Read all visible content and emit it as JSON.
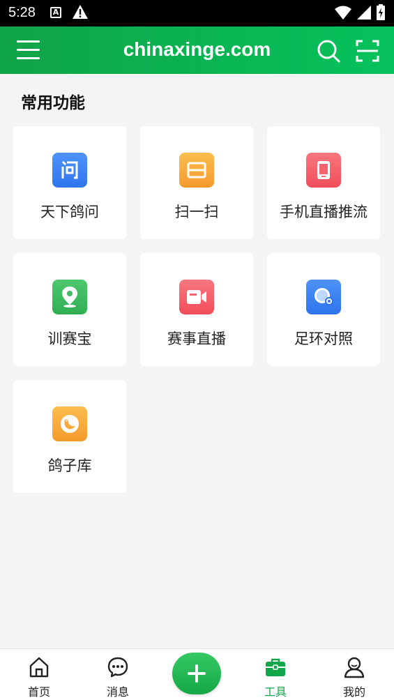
{
  "status_bar": {
    "time": "5:28",
    "icons": [
      "a-notification-icon",
      "warning-icon",
      "wifi-icon",
      "signal-icon",
      "battery-charging-icon"
    ]
  },
  "app_bar": {
    "title": "chinaxinge.com",
    "icons": [
      "menu-icon",
      "search-icon",
      "scan-icon"
    ]
  },
  "section": {
    "title": "常用功能"
  },
  "tiles": [
    {
      "label": "天下鸽问",
      "icon": "question-icon",
      "color": "#3e86f5"
    },
    {
      "label": "扫一扫",
      "icon": "scan-icon",
      "color": "#f8a83a"
    },
    {
      "label": "手机直播推流",
      "icon": "phone-icon",
      "color": "#f5606a"
    },
    {
      "label": "训赛宝",
      "icon": "location-pin-icon",
      "color": "#3dbb5e"
    },
    {
      "label": "赛事直播",
      "icon": "video-icon",
      "color": "#f5606a"
    },
    {
      "label": "足环对照",
      "icon": "ring-search-icon",
      "color": "#3e86f5"
    },
    {
      "label": "鸽子库",
      "icon": "pigeon-icon",
      "color": "#f8a83a"
    }
  ],
  "bottom_nav": {
    "items": [
      {
        "label": "首页",
        "icon": "home-icon",
        "active": false
      },
      {
        "label": "消息",
        "icon": "chat-icon",
        "active": false
      },
      {
        "label": "工具",
        "icon": "toolbox-icon",
        "active": true
      },
      {
        "label": "我的",
        "icon": "user-icon",
        "active": false
      }
    ],
    "fab_icon": "plus-icon",
    "active_color": "#12a64b"
  }
}
